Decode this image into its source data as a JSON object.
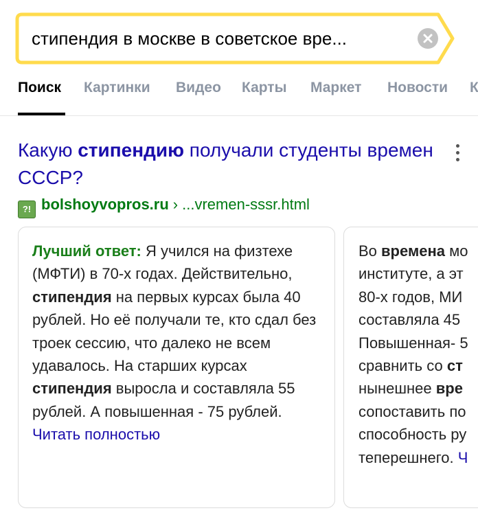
{
  "search": {
    "query": "стипендия в москве в советское вре..."
  },
  "tabs": [
    "Поиск",
    "Картинки",
    "Видео",
    "Карты",
    "Маркет",
    "Новости",
    "К"
  ],
  "result": {
    "title_pre": "Какую ",
    "title_bold": "стипендию",
    "title_post": " получали студенты времен СССР?",
    "favicon_text": "?!",
    "domain": "bolshoyvopros.ru",
    "separator": "›",
    "path": "...vremen-sssr.html"
  },
  "card1": {
    "label": "Лучший ответ:",
    "t1": " Я учился на физтехе (МФТИ) в 70-х годах. Действительно, ",
    "b1": "стипендия",
    "t2": " на первых курсах была 40 рублей. Но её получали те, кто сдал без троек сессию, что далеко не всем удавалось. На старших курсах ",
    "b2": "стипендия",
    "t3": " выросла и составляла 55 рублей. А повышенная - 75 рублей. ",
    "read_more": "Читать полностью"
  },
  "card2": {
    "l1a": "Во ",
    "l1b": "времена",
    "l1c": " мо",
    "l2": "институте, а эт",
    "l3": "80-х годов, МИ",
    "l4": "составляла 45",
    "l5": "Повышенная- 5",
    "l6a": "сравнить со ",
    "l6b": "ст",
    "l7a": "нынешнее ",
    "l7b": "вре",
    "l8": "сопоставить по",
    "l9": "способность ру",
    "l10a": "теперешнего. ",
    "l10b": "Ч"
  }
}
